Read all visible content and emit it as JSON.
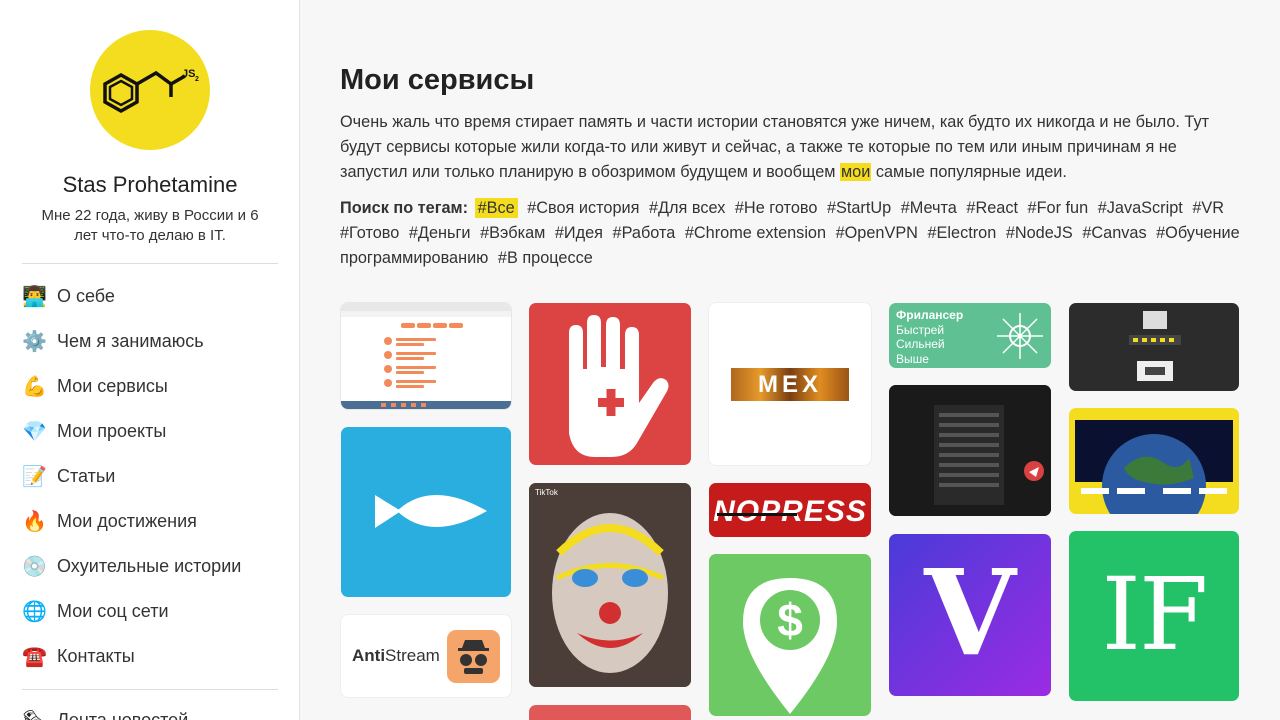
{
  "profile": {
    "logo_text": "JS",
    "logo_sub": "2",
    "name": "Stas Prohetamine",
    "bio": "Мне 22 года, живу в России и 6 лет что-то делаю в IT."
  },
  "nav": [
    {
      "icon": "👨‍💻",
      "icon_name": "technologist-icon",
      "label": "О себе"
    },
    {
      "icon": "⚙️",
      "icon_name": "gear-icon",
      "label": "Чем я занимаюсь"
    },
    {
      "icon": "💪",
      "icon_name": "flexed-biceps-icon",
      "label": "Мои сервисы"
    },
    {
      "icon": "💎",
      "icon_name": "gem-icon",
      "label": "Мои проекты"
    },
    {
      "icon": "📝",
      "icon_name": "memo-icon",
      "label": "Статьи"
    },
    {
      "icon": "🔥",
      "icon_name": "fire-icon",
      "label": "Мои достижения"
    },
    {
      "icon": "💿",
      "icon_name": "disc-icon",
      "label": "Охуительные истории"
    },
    {
      "icon": "🌐",
      "icon_name": "globe-icon",
      "label": "Мои соц сети"
    },
    {
      "icon": "☎️",
      "icon_name": "telephone-icon",
      "label": "Контакты"
    },
    {
      "icon": "🗞",
      "icon_name": "newspaper-icon",
      "label": "Лента новостей"
    }
  ],
  "main": {
    "title": "Мои сервисы",
    "intro_before": "Очень жаль что время стирает память и части истории становятся уже ничем, как будто их никогда и не было. Тут будут сервисы которые жили когда-то или живут и сейчас, а также те которые по тем или иным причинам я не запустил или только планирую в обозримом будущем и вообщем ",
    "intro_highlight": "мои",
    "intro_after": " самые популярные идеи.",
    "tags_label": "Поиск по тегам:",
    "tags": [
      "#Все",
      "#Своя история",
      "#Для всех",
      "#Не готово",
      "#StartUp",
      "#Мечта",
      "#React",
      "#For fun",
      "#JavaScript",
      "#VR",
      "#Готово",
      "#Деньги",
      "#Вэбкам",
      "#Идея",
      "#Работа",
      "#Chrome extension",
      "#OpenVPN",
      "#Electron",
      "#NodeJS",
      "#Canvas",
      "#Обучение программированию",
      "#В процессе"
    ],
    "active_tag": "#Все"
  },
  "cards": {
    "mex_text": "MEX",
    "nopress_text": "NOPRESS",
    "freelancer_lines": [
      "Фрилансер",
      "Быстрей",
      "Сильней",
      "Выше"
    ],
    "antistream_bold": "Anti",
    "antistream_rest": "Stream",
    "if_text": "IF",
    "v_text": "V",
    "tiktok_text": "TikTok"
  },
  "colors": {
    "accent": "#f3dd1e",
    "hand_red": "#dc4444",
    "fish_blue": "#2aaee0",
    "dollar_green": "#6dc963",
    "if_green": "#23c168",
    "freelancer_green": "#5fc093",
    "purple_start": "#4a3bd8",
    "purple_end": "#9b2be3"
  }
}
